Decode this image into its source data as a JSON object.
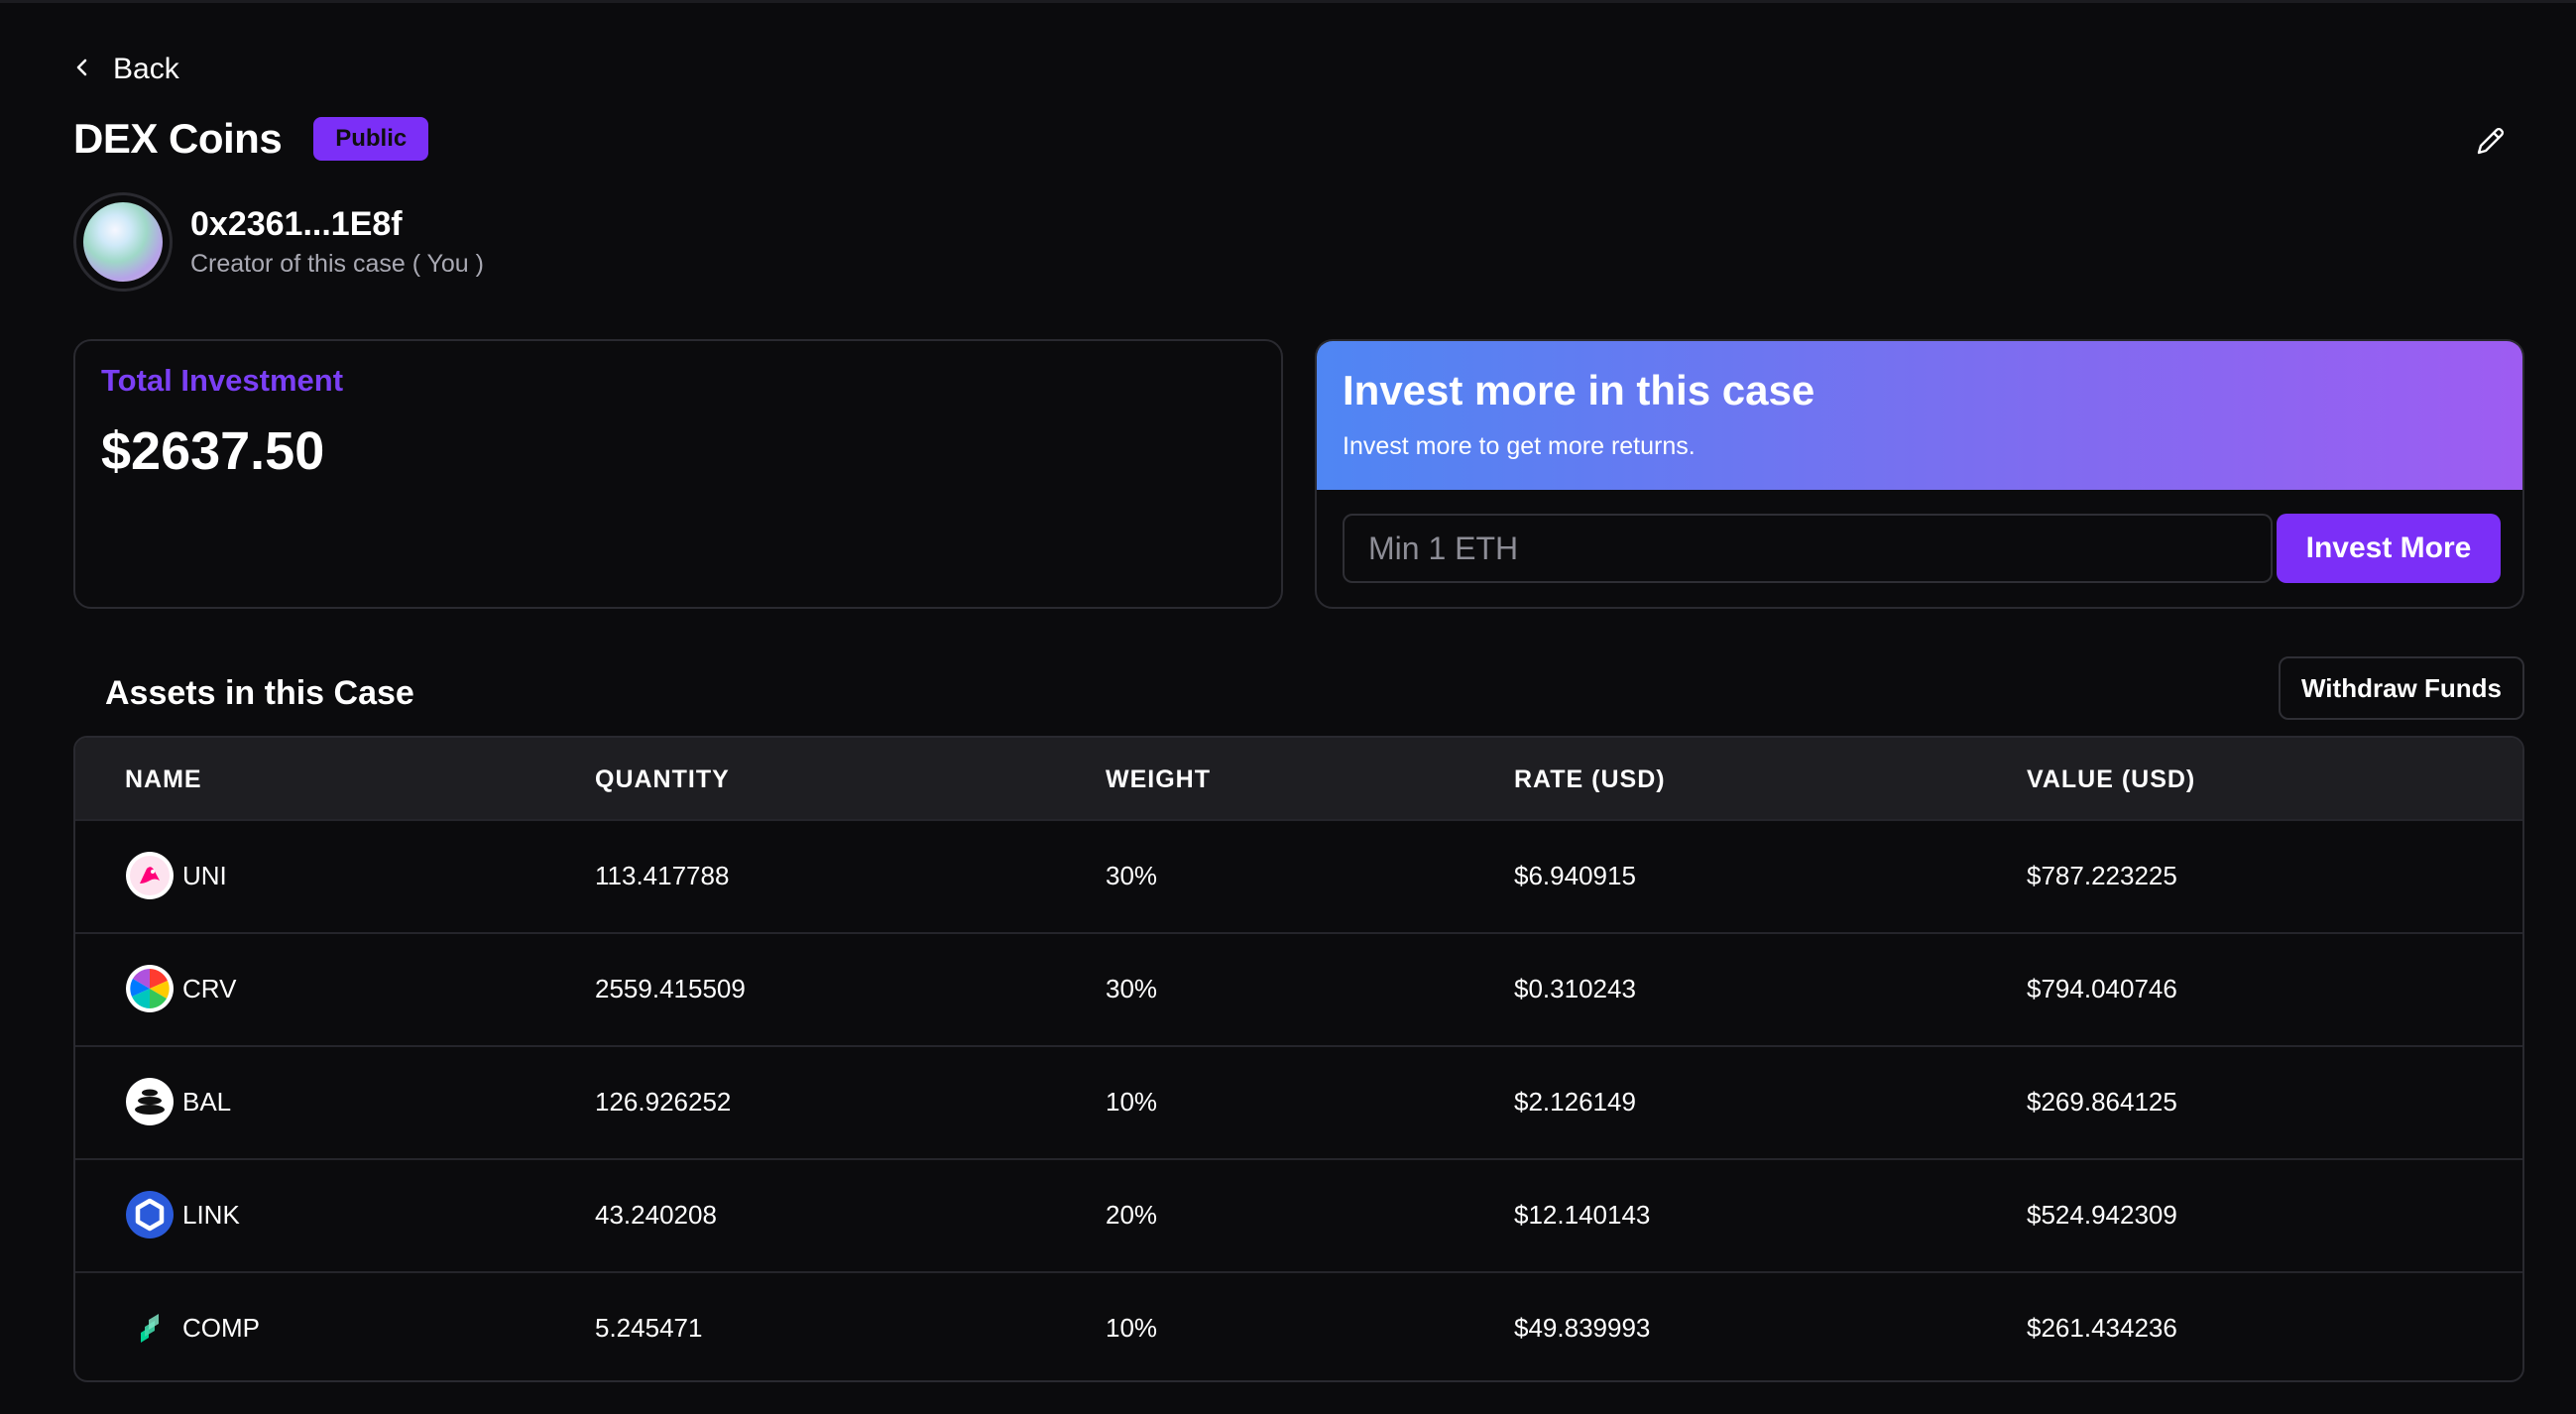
{
  "nav": {
    "back_label": "Back"
  },
  "case": {
    "title": "DEX Coins",
    "visibility_badge": "Public"
  },
  "creator": {
    "address": "0x2361...1E8f",
    "role": "Creator of this case ( You )"
  },
  "total_investment": {
    "label": "Total Investment",
    "amount": "$2637.50"
  },
  "invest_more": {
    "title": "Invest more in this case",
    "subtitle": "Invest more to get more returns.",
    "input_placeholder": "Min 1 ETH",
    "input_value": "",
    "button_label": "Invest More"
  },
  "assets": {
    "title": "Assets in this Case",
    "withdraw_label": "Withdraw Funds",
    "columns": [
      "NAME",
      "QUANTITY",
      "WEIGHT",
      "RATE (USD)",
      "VALUE (USD)"
    ],
    "rows": [
      {
        "name": "UNI",
        "icon": "uniswap-icon",
        "quantity": "113.417788",
        "weight": "30%",
        "rate": "$6.940915",
        "value": "$787.223225"
      },
      {
        "name": "CRV",
        "icon": "curve-icon",
        "quantity": "2559.415509",
        "weight": "30%",
        "rate": "$0.310243",
        "value": "$794.040746"
      },
      {
        "name": "BAL",
        "icon": "balancer-icon",
        "quantity": "126.926252",
        "weight": "10%",
        "rate": "$2.126149",
        "value": "$269.864125"
      },
      {
        "name": "LINK",
        "icon": "chainlink-icon",
        "quantity": "43.240208",
        "weight": "20%",
        "rate": "$12.140143",
        "value": "$524.942309"
      },
      {
        "name": "COMP",
        "icon": "compound-icon",
        "quantity": "5.245471",
        "weight": "10%",
        "rate": "$49.839993",
        "value": "$261.434236"
      }
    ]
  },
  "colors": {
    "accent": "#7b2ff7",
    "background": "#0b0b0d",
    "header_row": "#1e1e22",
    "banner_gradient_start": "#4f86f3",
    "banner_gradient_end": "#9e5cf2"
  }
}
